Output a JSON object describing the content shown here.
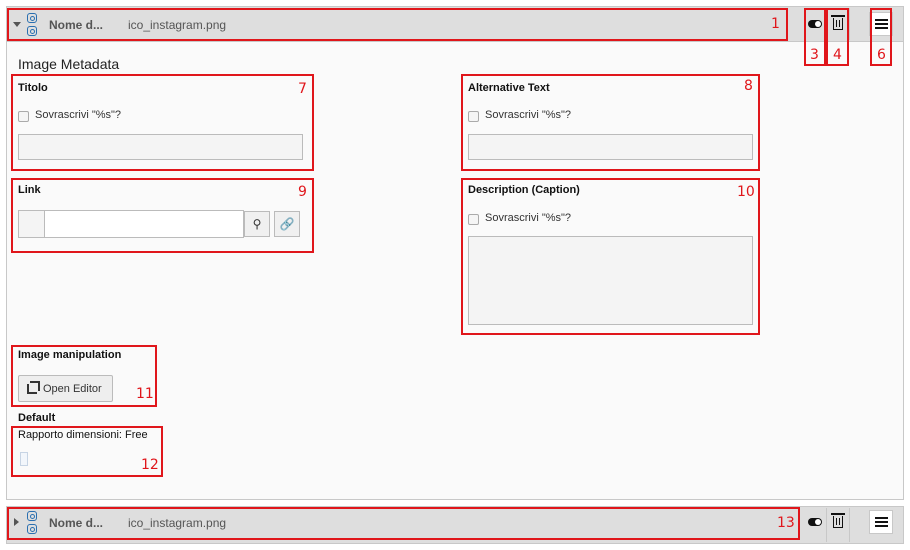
{
  "top_bar": {
    "title": "Nome d...",
    "filename": "ico_instagram.png"
  },
  "bottom_bar": {
    "title": "Nome d...",
    "filename": "ico_instagram.png"
  },
  "section": {
    "title": "Image Metadata"
  },
  "fields": {
    "titolo": {
      "label": "Titolo",
      "override": "Sovrascrivi \"%s\"?"
    },
    "alt": {
      "label": "Alternative Text",
      "override": "Sovrascrivi \"%s\"?"
    },
    "link": {
      "label": "Link",
      "wizard_icon": "⚲",
      "link_icon": "🔗"
    },
    "description": {
      "label": "Description (Caption)",
      "override": "Sovrascrivi \"%s\"?"
    }
  },
  "image_manipulation": {
    "label": "Image manipulation",
    "button": "Open Editor"
  },
  "default": {
    "label": "Default",
    "ratio": "Rapporto dimensioni: Free"
  },
  "annotations": [
    "1",
    "3",
    "4",
    "6",
    "7",
    "8",
    "9",
    "10",
    "11",
    "12",
    "13"
  ],
  "colors": {
    "annotation": "#e0161b",
    "header_bg": "#dedede"
  }
}
